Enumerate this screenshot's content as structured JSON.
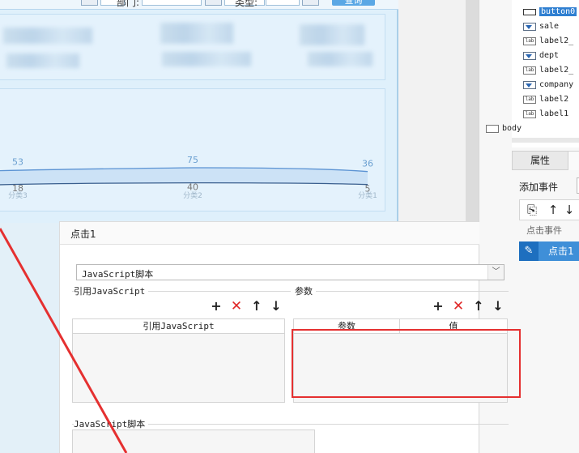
{
  "param_bar": {
    "labels": [
      "部门:",
      "类型:"
    ],
    "query_button": "查询"
  },
  "chart": {
    "categories": [
      "分类3",
      "分类2",
      "分类1"
    ],
    "series_upper": [
      53,
      75,
      36
    ],
    "series_lower": [
      18,
      40,
      5
    ]
  },
  "tree": {
    "items": [
      {
        "icon": "button-icon",
        "label": "button0",
        "selected": true
      },
      {
        "icon": "combo-icon",
        "label": "sale"
      },
      {
        "icon": "label-icon",
        "label": "label2_"
      },
      {
        "icon": "combo-icon",
        "label": "dept"
      },
      {
        "icon": "label-icon",
        "label": "label2_"
      },
      {
        "icon": "combo-icon",
        "label": "company"
      },
      {
        "icon": "label-icon",
        "label": "label2"
      },
      {
        "icon": "label-icon",
        "label": "label1"
      },
      {
        "icon": "body-icon",
        "label": "body"
      }
    ]
  },
  "properties": {
    "tab_label": "属性",
    "add_event_label": "添加事件",
    "event_group": "点击事件",
    "event_name": "点击1"
  },
  "dialog": {
    "title": "点击1",
    "script_type": "JavaScript脚本",
    "ref_js_label": "引用JavaScript",
    "params_label": "参数",
    "ref_js_header": "引用JavaScript",
    "param_header": "参数",
    "value_header": "值",
    "script_section_label": "JavaScript脚本"
  },
  "colors": {
    "selection": "#2f7fd1",
    "event_row": "#3f8fd8",
    "annotation": "#e53030",
    "delete": "#e02828"
  }
}
